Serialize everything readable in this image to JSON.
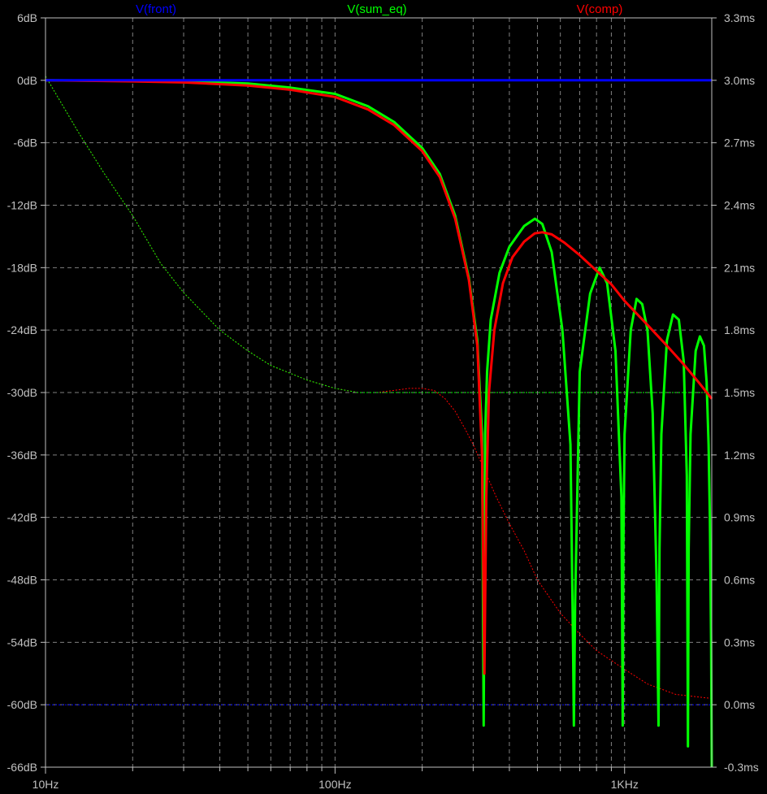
{
  "chart_data": {
    "type": "line",
    "title": "",
    "xscale": "log",
    "xlim": [
      10,
      2000
    ],
    "x_ticks": [
      {
        "value": 10,
        "label": "10Hz"
      },
      {
        "value": 100,
        "label": "100Hz"
      },
      {
        "value": 1000,
        "label": "1KHz"
      }
    ],
    "y_left": {
      "lim": [
        -66,
        6
      ],
      "ticks": [
        6,
        0,
        -6,
        -12,
        -18,
        -24,
        -30,
        -36,
        -42,
        -48,
        -54,
        -60,
        -66
      ],
      "tick_labels": [
        "6dB",
        "0dB",
        "-6dB",
        "-12dB",
        "-18dB",
        "-24dB",
        "-30dB",
        "-36dB",
        "-42dB",
        "-48dB",
        "-54dB",
        "-60dB",
        "-66dB"
      ]
    },
    "y_right": {
      "lim": [
        -0.3,
        3.3
      ],
      "ticks": [
        3.3,
        3.0,
        2.7,
        2.4,
        2.1,
        1.8,
        1.5,
        1.2,
        0.9,
        0.6,
        0.3,
        0.0,
        -0.3
      ],
      "tick_labels": [
        "3.3ms",
        "3.0ms",
        "2.7ms",
        "2.4ms",
        "2.1ms",
        "1.8ms",
        "1.5ms",
        "1.2ms",
        "0.9ms",
        "0.6ms",
        "0.3ms",
        "0.0ms",
        "-0.3ms"
      ]
    },
    "grid": true,
    "legend_position": "top",
    "series": [
      {
        "name": "V(front)",
        "color": "#0000ff",
        "magnitude_db": {
          "x": [
            10,
            2000
          ],
          "y": [
            0,
            0
          ]
        },
        "group_delay_ms": {
          "x": [
            10,
            2000
          ],
          "y": [
            0.0,
            0.0
          ]
        }
      },
      {
        "name": "V(sum_eq)",
        "color": "#00ff00",
        "magnitude_db": {
          "x": [
            10,
            20,
            30,
            50,
            70,
            100,
            130,
            160,
            200,
            230,
            260,
            290,
            310,
            322,
            326,
            330,
            335,
            345,
            370,
            400,
            450,
            490,
            520,
            560,
            610,
            650,
            664,
            668,
            675,
            700,
            760,
            820,
            870,
            930,
            975,
            985,
            990,
            1000,
            1050,
            1100,
            1150,
            1200,
            1250,
            1290,
            1310,
            1320,
            1340,
            1400,
            1470,
            1540,
            1600,
            1640,
            1655,
            1665,
            1690,
            1760,
            1820,
            1880,
            1920,
            1950,
            1970,
            1990,
            2000
          ],
          "y": [
            0,
            -0.05,
            -0.1,
            -0.3,
            -0.7,
            -1.3,
            -2.5,
            -4.0,
            -6.5,
            -9.0,
            -13.0,
            -19.0,
            -25.0,
            -34.0,
            -62.0,
            -34.0,
            -28.0,
            -23.0,
            -18.5,
            -16.0,
            -14.0,
            -13.3,
            -13.8,
            -16.5,
            -24.0,
            -35.0,
            -55.0,
            -62.0,
            -50.0,
            -28.0,
            -20.5,
            -18.0,
            -19.5,
            -26.0,
            -40.0,
            -62.0,
            -45.0,
            -34.0,
            -24.0,
            -21.0,
            -21.5,
            -24.0,
            -32.0,
            -48.0,
            -62.0,
            -45.0,
            -34.0,
            -25.0,
            -22.5,
            -23.0,
            -27.0,
            -38.0,
            -64.0,
            -45.0,
            -34.0,
            -26.0,
            -24.6,
            -25.5,
            -29.0,
            -35.0,
            -42.0,
            -54.0,
            -66.0
          ]
        },
        "group_delay_ms": {
          "x": [
            10,
            13,
            16,
            20,
            25,
            30,
            40,
            50,
            60,
            80,
            100,
            120,
            140,
            160,
            180,
            200,
            220,
            260,
            300,
            400,
            500,
            700,
            1000,
            1500,
            2000
          ],
          "y": [
            3.02,
            2.75,
            2.55,
            2.35,
            2.12,
            1.98,
            1.8,
            1.7,
            1.63,
            1.56,
            1.52,
            1.5,
            1.5,
            1.5,
            1.5,
            1.5,
            1.5,
            1.5,
            1.5,
            1.5,
            1.5,
            1.5,
            1.5,
            1.5,
            1.5
          ]
        }
      },
      {
        "name": "V(comp)",
        "color": "#ff0000",
        "magnitude_db": {
          "x": [
            10,
            20,
            30,
            50,
            70,
            100,
            130,
            160,
            200,
            230,
            260,
            290,
            310,
            322,
            328,
            333,
            340,
            355,
            380,
            410,
            450,
            490,
            520,
            560,
            620,
            700,
            800,
            900,
            1000,
            1200,
            1400,
            1600,
            1800,
            2000
          ],
          "y": [
            0,
            -0.1,
            -0.2,
            -0.5,
            -0.9,
            -1.6,
            -2.8,
            -4.3,
            -6.8,
            -9.3,
            -13.3,
            -19.2,
            -25.5,
            -36.0,
            -57.0,
            -40.0,
            -30.0,
            -24.0,
            -19.5,
            -17.0,
            -15.5,
            -14.7,
            -14.6,
            -14.8,
            -15.6,
            -16.8,
            -18.3,
            -19.6,
            -21.2,
            -23.5,
            -25.5,
            -27.3,
            -29.0,
            -30.6
          ]
        },
        "group_delay_ms": {
          "x": [
            10,
            13,
            16,
            20,
            25,
            30,
            40,
            50,
            60,
            80,
            100,
            120,
            140,
            160,
            180,
            200,
            220,
            240,
            260,
            280,
            300,
            330,
            360,
            400,
            450,
            500,
            600,
            700,
            800,
            1000,
            1200,
            1500,
            2000
          ],
          "y": [
            3.02,
            2.75,
            2.55,
            2.35,
            2.12,
            1.98,
            1.8,
            1.7,
            1.63,
            1.56,
            1.52,
            1.5,
            1.5,
            1.51,
            1.52,
            1.52,
            1.51,
            1.47,
            1.41,
            1.33,
            1.25,
            1.12,
            1.0,
            0.87,
            0.74,
            0.6,
            0.44,
            0.34,
            0.26,
            0.17,
            0.1,
            0.05,
            0.03
          ]
        }
      }
    ]
  }
}
